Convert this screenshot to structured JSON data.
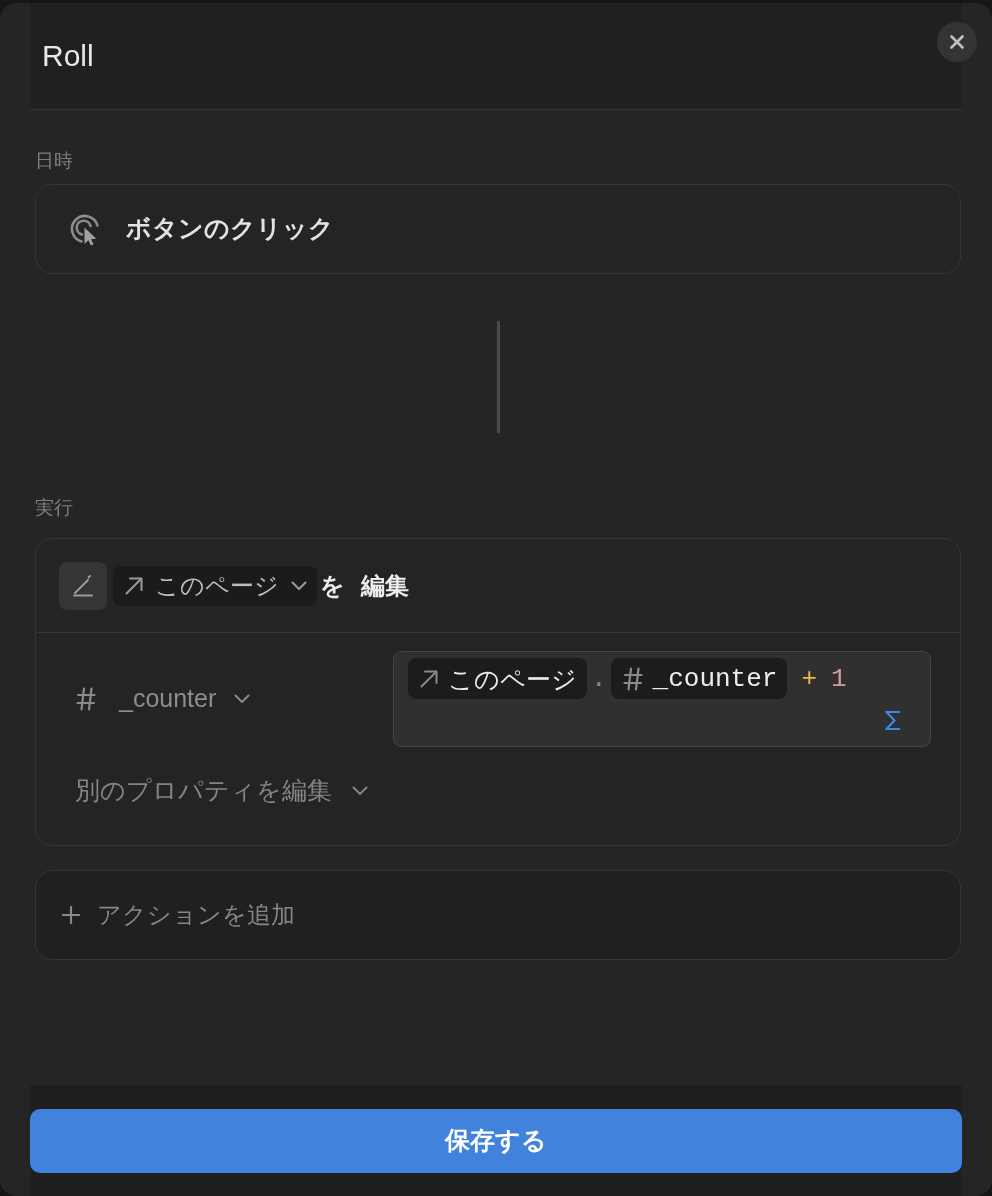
{
  "window": {
    "title": "Roll"
  },
  "trigger": {
    "section_label": "日時",
    "label": "ボタンのクリック"
  },
  "action": {
    "section_label": "実行",
    "target": {
      "label": "このページ"
    },
    "particle": "を",
    "verb": "編集",
    "property": {
      "label": "_counter"
    },
    "formula": {
      "tokens": [
        {
          "kind": "page",
          "text": "このページ"
        },
        {
          "kind": "dot",
          "text": "."
        },
        {
          "kind": "property",
          "text": "_counter"
        },
        {
          "kind": "operator",
          "text": "+"
        },
        {
          "kind": "number",
          "text": "1"
        }
      ]
    },
    "more_properties": {
      "label": "別のプロパティを編集"
    }
  },
  "add_action": {
    "label": "アクションを追加"
  },
  "save_button": {
    "label": "保存する"
  }
}
